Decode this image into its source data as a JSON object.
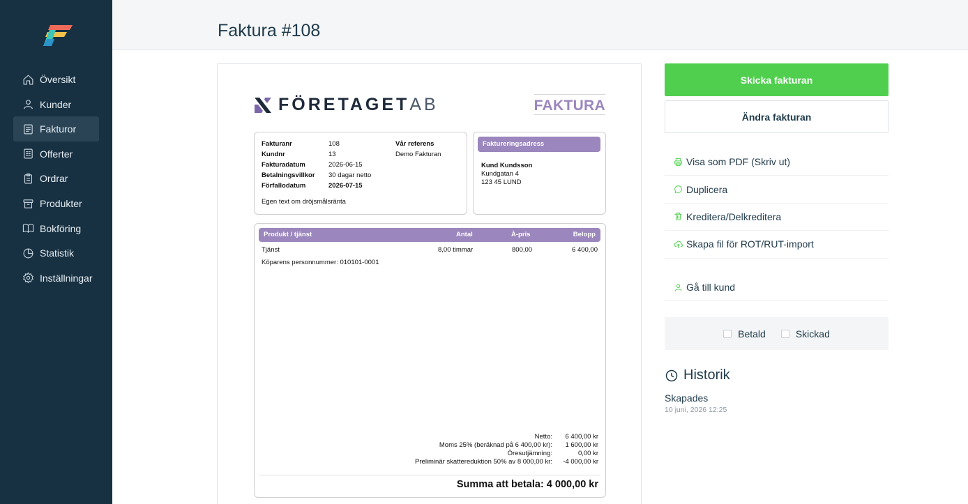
{
  "sidebar": {
    "items": [
      {
        "label": "Översikt",
        "icon": "home-icon"
      },
      {
        "label": "Kunder",
        "icon": "user-icon"
      },
      {
        "label": "Fakturor",
        "icon": "document-icon",
        "active": true
      },
      {
        "label": "Offerter",
        "icon": "calculator-icon"
      },
      {
        "label": "Ordrar",
        "icon": "clipboard-icon"
      },
      {
        "label": "Produkter",
        "icon": "archive-icon"
      },
      {
        "label": "Bokföring",
        "icon": "book-icon"
      },
      {
        "label": "Statistik",
        "icon": "pie-chart-icon"
      },
      {
        "label": "Inställningar",
        "icon": "gear-icon"
      }
    ]
  },
  "header": {
    "title": "Faktura #108"
  },
  "invoice": {
    "company": {
      "name_main": "FÖRETAGET",
      "name_suffix": "AB"
    },
    "doc_type": "FAKTURA",
    "info": [
      {
        "label": "Fakturanr",
        "value": "108"
      },
      {
        "label": "Kundnr",
        "value": "13"
      },
      {
        "label": "Fakturadatum",
        "value": "2026-06-15"
      },
      {
        "label": "Betalningsvillkor",
        "value": "30 dagar netto"
      },
      {
        "label": "Förfallodatum",
        "value": "2026-07-15"
      }
    ],
    "reference_label": "Vår referens",
    "reference_value": "Demo Fakturan",
    "custom_text": "Egen text om dröjsmålsränta",
    "billing": {
      "title": "Faktureringsadress",
      "name": "Kund Kundsson",
      "street": "Kundgatan 4",
      "city": "123 45 LUND"
    },
    "columns": {
      "product": "Produkt / tjänst",
      "qty": "Antal",
      "price": "À-pris",
      "amount": "Belopp"
    },
    "items": [
      {
        "product": "Tjänst",
        "qty": "8,00 timmar",
        "price": "800,00",
        "amount": "6 400,00"
      }
    ],
    "buyer_note": "Köparens personnummer: 010101-0001",
    "totals": [
      {
        "label": "Netto:",
        "value": "6 400,00 kr"
      },
      {
        "label": "Moms 25% (beräknad på 6 400,00 kr):",
        "value": "1 600,00 kr"
      },
      {
        "label": "Öresutjämning:",
        "value": "0,00 kr"
      },
      {
        "label": "Preliminär skattereduktion 50% av 8 000,00 kr:",
        "value": "-4 000,00 kr"
      }
    ],
    "sum": "Summa att betala: 4 000,00 kr"
  },
  "panel": {
    "send_label": "Skicka fakturan",
    "edit_label": "Ändra fakturan",
    "actions": [
      {
        "label": "Visa som PDF (Skriv ut)",
        "icon": "printer-icon"
      },
      {
        "label": "Duplicera",
        "icon": "copy-icon"
      },
      {
        "label": "Kreditera/Delkreditera",
        "icon": "trash-icon"
      },
      {
        "label": "Skapa fil för ROT/RUT-import",
        "icon": "cloud-upload-icon"
      }
    ],
    "goto_customer": "Gå till kund",
    "paid_label": "Betald",
    "sent_label": "Skickad",
    "history_title": "Historik",
    "history": {
      "event": "Skapades",
      "time": "10 juni, 2026 12:25"
    }
  },
  "colors": {
    "sidebar": "#183142",
    "accent_green": "#50cf4f",
    "invoice_purple": "#9b86bd"
  }
}
